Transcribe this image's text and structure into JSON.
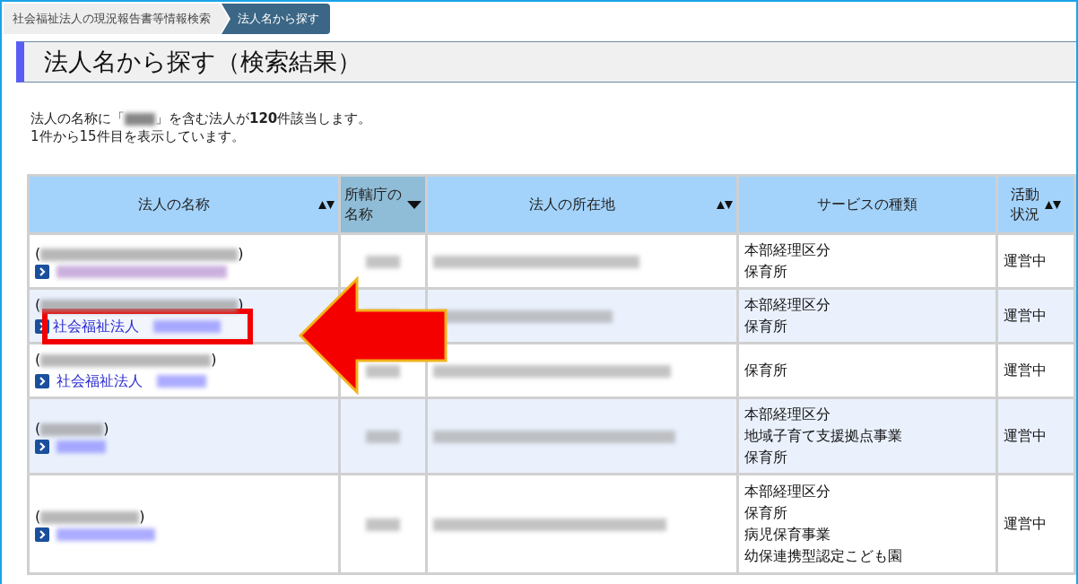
{
  "breadcrumb": [
    {
      "label": "社会福祉法人の現況報告書等情報検索",
      "selected": false
    },
    {
      "label": "法人名から探す",
      "selected": true
    }
  ],
  "page_title": "法人名から探す（検索結果）",
  "summary": {
    "before": "法人の名称に「",
    "after": "」を含む法人が",
    "count": "120",
    "unit": "件該当します。",
    "range": "1件から15件目を表示しています。"
  },
  "table": {
    "columns": [
      {
        "label": "法人の名称",
        "kind": "sortable",
        "selected": false
      },
      {
        "label": "所轄庁の名称",
        "kind": "sorted-desc",
        "selected": true
      },
      {
        "label": "法人の所在地",
        "kind": "sortable",
        "selected": false
      },
      {
        "label": "サービスの種類",
        "kind": "plain",
        "selected": false
      },
      {
        "label": "活動状況",
        "kind": "sortable",
        "selected": false
      }
    ],
    "rows": [
      {
        "name_prefix": null,
        "visited": true,
        "highlighted": false,
        "services": [
          "本部経理区分",
          "保育所"
        ],
        "status": "運営中"
      },
      {
        "name_prefix": "社会福祉法人",
        "visited": false,
        "highlighted": true,
        "services": [
          "本部経理区分",
          "保育所"
        ],
        "status": "運営中"
      },
      {
        "name_prefix": "社会福祉法人",
        "visited": false,
        "highlighted": false,
        "services": [
          "保育所"
        ],
        "status": "運営中"
      },
      {
        "name_prefix": null,
        "visited": false,
        "highlighted": false,
        "services": [
          "本部経理区分",
          "地域子育て支援拠点事業",
          "保育所"
        ],
        "status": "運営中"
      },
      {
        "name_prefix": null,
        "visited": false,
        "highlighted": false,
        "services": [
          "本部経理区分",
          "保育所",
          "病児保育事業",
          "幼保連携型認定こども園"
        ],
        "status": "運営中"
      }
    ]
  },
  "paren_open": "(",
  "paren_close": ")"
}
